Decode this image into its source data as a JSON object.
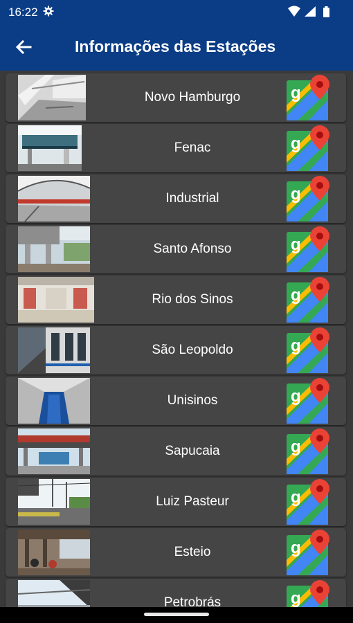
{
  "status_bar": {
    "time": "16:22"
  },
  "header": {
    "title": "Informações das Estações"
  },
  "stations": [
    {
      "name": "Novo Hamburgo"
    },
    {
      "name": "Fenac"
    },
    {
      "name": "Industrial"
    },
    {
      "name": "Santo Afonso"
    },
    {
      "name": "Rio dos Sinos"
    },
    {
      "name": "São Leopoldo"
    },
    {
      "name": "Unisinos"
    },
    {
      "name": "Sapucaia"
    },
    {
      "name": "Luiz Pasteur"
    },
    {
      "name": "Esteio"
    },
    {
      "name": "Petrobrás"
    }
  ],
  "colors": {
    "primary": "#0a3d86",
    "background": "#3a3a3a",
    "row": "#454545",
    "maps_green": "#34a853",
    "maps_blue": "#4285f4",
    "maps_yellow": "#fbbc04",
    "maps_red": "#ea4335"
  },
  "icons": [
    "settings-gear-icon",
    "wifi-icon",
    "cellular-signal-icon",
    "battery-icon",
    "back-arrow-icon",
    "google-maps-icon"
  ]
}
